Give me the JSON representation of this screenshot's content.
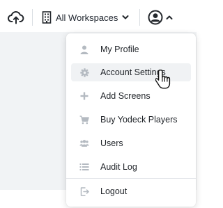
{
  "header": {
    "upload_icon": "cloud-upload-icon",
    "workspace_icon": "building-icon",
    "workspace_label": "All Workspaces",
    "workspace_chevron": "chevron-down-icon",
    "user_icon": "user-circle-icon",
    "user_chevron": "chevron-up-icon"
  },
  "menu": {
    "items": [
      {
        "label": "My Profile",
        "icon": "person-icon"
      },
      {
        "label": "Account Settings",
        "icon": "gear-icon",
        "hovered": true
      },
      {
        "label": "Add Screens",
        "icon": "plus-icon"
      },
      {
        "label": "Buy Yodeck Players",
        "icon": "cart-icon"
      },
      {
        "label": "Users",
        "icon": "users-icon"
      },
      {
        "label": "Audit Log",
        "icon": "list-icon"
      }
    ],
    "footer_items": [
      {
        "label": "Logout",
        "icon": "logout-icon"
      }
    ]
  },
  "colors": {
    "text": "#1f2328",
    "icon_gray": "#b4bac1",
    "hover_bg": "#f0f2f4",
    "page_bg": "#f1f3f5"
  }
}
